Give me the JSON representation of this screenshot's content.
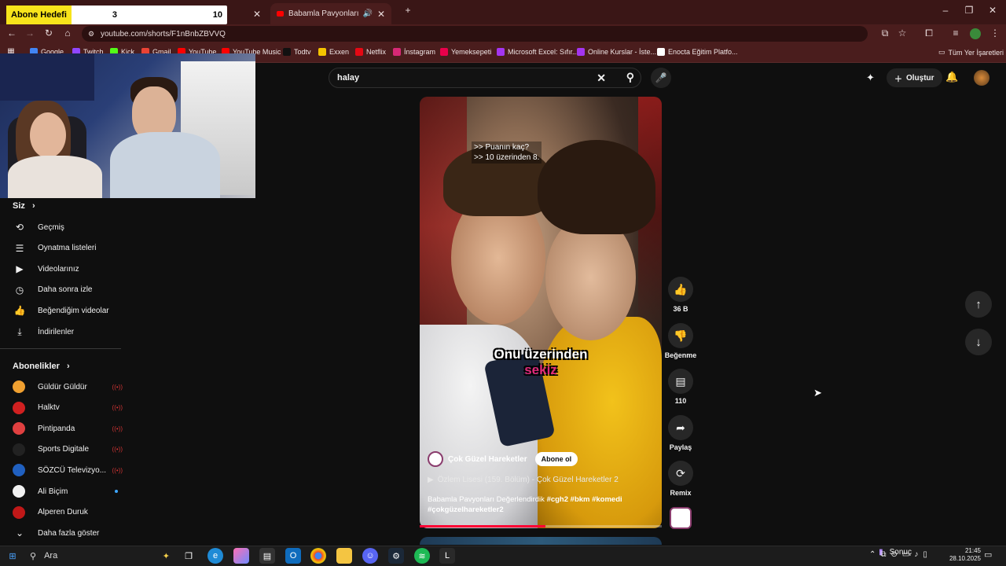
{
  "browser": {
    "tabs": [
      {
        "label": "",
        "active": false
      },
      {
        "label": "Babamla Pavyonları Değerl",
        "active": true
      }
    ],
    "url": "youtube.com/shorts/F1nBnbZBVVQ",
    "bookmarks": [
      {
        "label": "Google",
        "color": "#4285f4"
      },
      {
        "label": "Twitch",
        "color": "#9146ff"
      },
      {
        "label": "Kick",
        "color": "#53fc18"
      },
      {
        "label": "Gmail",
        "color": "#ea4335"
      },
      {
        "label": "YouTube",
        "color": "#ff0000"
      },
      {
        "label": "YouTube Music",
        "color": "#ff0000"
      },
      {
        "label": "Todtv",
        "color": "#111111"
      },
      {
        "label": "Exxen",
        "color": "#f5c400"
      },
      {
        "label": "Netflix",
        "color": "#e50914"
      },
      {
        "label": "İnstagram",
        "color": "#d62976"
      },
      {
        "label": "Yemeksepeti",
        "color": "#ea004b"
      },
      {
        "label": "Microsoft Excel: Sıfır...",
        "color": "#a435f0"
      },
      {
        "label": "Online Kurslar - İste...",
        "color": "#a435f0"
      },
      {
        "label": "Enocta Eğitim Platfo...",
        "color": "#ffffff"
      }
    ],
    "all_bookmarks": "Tüm Yer İşaretleri"
  },
  "overlay": {
    "goal_label": "Abone Hedefi",
    "goal_current": "3",
    "goal_target": "10"
  },
  "youtube": {
    "search": {
      "value": "halay"
    },
    "create_label": "Oluştur",
    "sidebar": {
      "you_section": "Siz",
      "you_items": [
        {
          "label": "Geçmiş",
          "icon": "history-icon"
        },
        {
          "label": "Oynatma listeleri",
          "icon": "playlist-icon"
        },
        {
          "label": "Videolarınız",
          "icon": "your-videos-icon"
        },
        {
          "label": "Daha sonra izle",
          "icon": "watch-later-icon"
        },
        {
          "label": "Beğendiğim videolar",
          "icon": "like-icon"
        },
        {
          "label": "İndirilenler",
          "icon": "download-icon"
        }
      ],
      "subs_section": "Abonelikler",
      "subs": [
        {
          "label": "Güldür Güldür",
          "color": "#f0a030",
          "live": true
        },
        {
          "label": "Halktv",
          "color": "#d02020",
          "live": true
        },
        {
          "label": "Pintipanda",
          "color": "#e04040",
          "live": true
        },
        {
          "label": "Sports Digitale",
          "color": "#222222",
          "live": true
        },
        {
          "label": "SÖZCÜ Televizyo...",
          "color": "#2060c0",
          "live": true
        },
        {
          "label": "Ali Biçim",
          "color": "#f1f1f1",
          "live": false,
          "new": true
        },
        {
          "label": "Alperen Duruk",
          "color": "#c01818",
          "live": false
        }
      ],
      "show_more": "Daha fazla göster"
    },
    "short": {
      "top_caption_1": ">> Puanın kaç?",
      "top_caption_2": ">> 10 üzerinden 8.",
      "caption_white": "Onu üzerinden",
      "caption_pink": "sekiz",
      "channel": "Çok Güzel Hareketler",
      "subscribe": "Abone ol",
      "playlist": "Özlem Lisesi (159. Bölüm) - Çok Güzel Hareketler 2",
      "description_title": "Babamla Pavyonları Değerlendirdik",
      "hashtags_1": "#cgh2 #bkm #komedi",
      "hashtags_2": "#çokgüzelhareketler2",
      "progress": 0.52
    },
    "actions": [
      {
        "label": "36 B",
        "icon": "like-icon"
      },
      {
        "label": "Beğenme",
        "icon": "dislike-icon"
      },
      {
        "label": "110",
        "icon": "comment-icon"
      },
      {
        "label": "Paylaş",
        "icon": "share-icon"
      },
      {
        "label": "Remix",
        "icon": "remix-icon"
      }
    ]
  },
  "taskbar": {
    "search": "Ara",
    "weather": "Sonuç",
    "time": "21:45",
    "date": "28.10.2025"
  }
}
